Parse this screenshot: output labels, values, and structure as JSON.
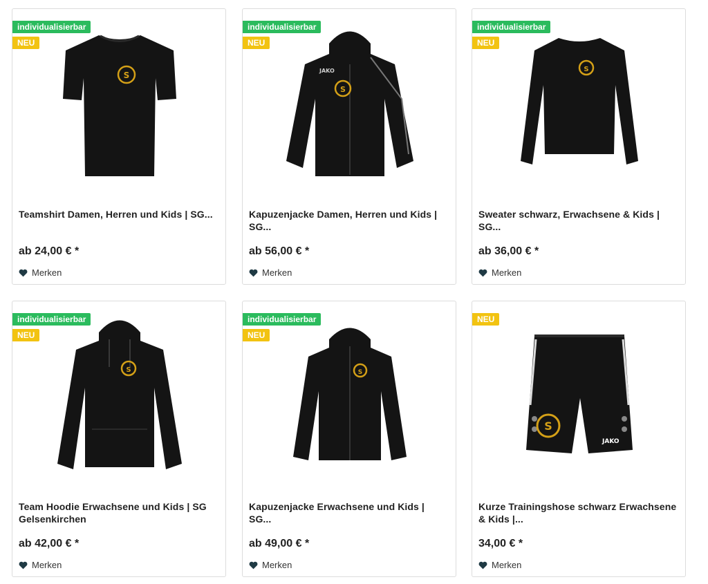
{
  "products": [
    {
      "badges": [
        {
          "type": "custom",
          "label": "individualisierbar"
        },
        {
          "type": "neu",
          "label": "NEU"
        }
      ],
      "title": "Teamshirt Damen, Herren und Kids | SG...",
      "price": "ab 24,00 € *",
      "wish_label": "Merken",
      "image": "tshirt"
    },
    {
      "badges": [
        {
          "type": "custom",
          "label": "individualisierbar"
        },
        {
          "type": "neu",
          "label": "NEU"
        }
      ],
      "title": "Kapuzenjacke Damen, Herren und Kids | SG...",
      "price": "ab 56,00 € *",
      "wish_label": "Merken",
      "image": "hooded-jacket"
    },
    {
      "badges": [
        {
          "type": "custom",
          "label": "individualisierbar"
        },
        {
          "type": "neu",
          "label": "NEU"
        }
      ],
      "title": "Sweater schwarz, Erwachsene & Kids | SG...",
      "price": "ab 36,00 € *",
      "wish_label": "Merken",
      "image": "sweater"
    },
    {
      "badges": [
        {
          "type": "custom",
          "label": "individualisierbar"
        },
        {
          "type": "neu",
          "label": "NEU"
        }
      ],
      "title": "Team Hoodie Erwachsene und Kids | SG Gelsenkirchen",
      "price": "ab 42,00 € *",
      "wish_label": "Merken",
      "image": "hoodie"
    },
    {
      "badges": [
        {
          "type": "custom",
          "label": "individualisierbar"
        },
        {
          "type": "neu",
          "label": "NEU"
        }
      ],
      "title": "Kapuzenjacke Erwachsene und Kids | SG...",
      "price": "ab 49,00 € *",
      "wish_label": "Merken",
      "image": "zip-hoodie"
    },
    {
      "badges": [
        {
          "type": "neu",
          "label": "NEU"
        }
      ],
      "title": "Kurze Trainingshose schwarz Erwachsene & Kids |...",
      "price": "34,00 € *",
      "wish_label": "Merken",
      "image": "shorts"
    }
  ],
  "colors": {
    "badge_custom": "#2bbb5d",
    "badge_neu": "#f2c311",
    "garment": "#141414",
    "logo": "#d4a017"
  }
}
